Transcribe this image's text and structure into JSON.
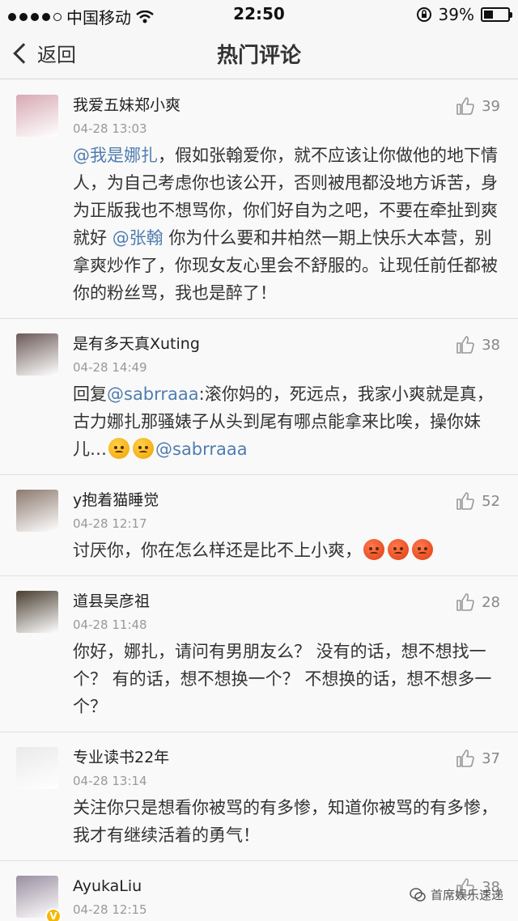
{
  "status_bar": {
    "carrier": "中国移动",
    "time": "22:50",
    "battery_text": "39%",
    "battery_level": 0.39
  },
  "nav": {
    "back_label": "返回",
    "title": "热门评论"
  },
  "comments": [
    {
      "username": "我爱五妹郑小爽",
      "time": "04-28 13:03",
      "likes": "39",
      "parts": [
        {
          "type": "mention",
          "text": "@我是娜扎"
        },
        {
          "type": "text",
          "text": "，假如张翰爱你，就不应该让你做他的地下情人，为自己考虑你也该公开，否则被甩都没地方诉苦，身为正版我也不想骂你，你们好自为之吧，不要在牵扯到爽就好 "
        },
        {
          "type": "mention",
          "text": "@张翰"
        },
        {
          "type": "text",
          "text": " 你为什么要和井柏然一期上快乐大本营，别拿爽炒作了，你现女友心里会不舒服的。让现任前任都被你的粉丝骂，我也是醉了！"
        }
      ]
    },
    {
      "username": "是有多天真Xuting",
      "time": "04-28 14:49",
      "likes": "38",
      "parts": [
        {
          "type": "text",
          "text": "回复"
        },
        {
          "type": "mention",
          "text": "@sabrraaa"
        },
        {
          "type": "text",
          "text": ":滚你妈的，死远点，我家小爽就是真，古力娜扎那骚婊子从头到尾有哪点能拿来比唉，操你妹儿…"
        },
        {
          "type": "emoji",
          "kind": "angry"
        },
        {
          "type": "emoji",
          "kind": "angry"
        },
        {
          "type": "mention",
          "text": "@sabrraaa"
        }
      ]
    },
    {
      "username": "y抱着猫睡觉",
      "time": "04-28 12:17",
      "likes": "52",
      "parts": [
        {
          "type": "text",
          "text": "讨厌你，你在怎么样还是比不上小爽，"
        },
        {
          "type": "emoji",
          "kind": "rage"
        },
        {
          "type": "emoji",
          "kind": "rage"
        },
        {
          "type": "emoji",
          "kind": "rage"
        }
      ]
    },
    {
      "username": "道县吴彦祖",
      "time": "04-28 11:48",
      "likes": "28",
      "parts": [
        {
          "type": "text",
          "text": "你好，娜扎，请问有男朋友么？ 没有的话，想不想找一个？ 有的话，想不想换一个？ 不想换的话，想不想多一个？"
        }
      ]
    },
    {
      "username": "专业读书22年",
      "time": "04-28 13:14",
      "likes": "37",
      "parts": [
        {
          "type": "text",
          "text": "关注你只是想看你被骂的有多惨，知道你被骂的有多惨，我才有继续活着的勇气！"
        }
      ]
    },
    {
      "username": "AyukaLiu",
      "time": "04-28 12:15",
      "likes": "38",
      "vip": "V",
      "parts": []
    }
  ],
  "watermark": "首席娱乐速递",
  "avatars": [
    "#d7a9b4",
    "#6b5a58",
    "#8c7a6e",
    "#4a3f30",
    "#eaeaea",
    "#9a8fa0"
  ]
}
